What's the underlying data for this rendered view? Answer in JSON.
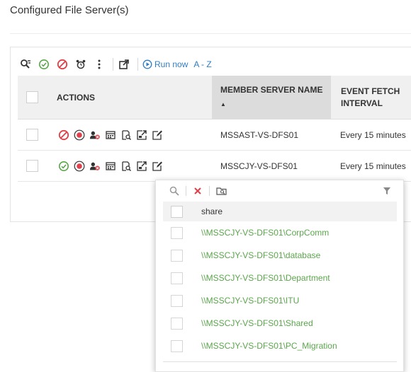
{
  "page": {
    "title": "Configured File Server(s)"
  },
  "toolbar": {
    "run_now_label": "Run now",
    "sort_label": "A - Z"
  },
  "table": {
    "columns": {
      "actions": "ACTIONS",
      "member_server": "MEMBER SERVER NAME",
      "sort_indicator": "▲",
      "interval": "EVENT FETCH INTERVAL"
    },
    "rows": [
      {
        "member_server": "MSSAST-VS-DFS01",
        "interval": "Every 15 minutes",
        "status": "disabled"
      },
      {
        "member_server": "MSSCJY-VS-DFS01",
        "interval": "Every 15 minutes",
        "status": "enabled"
      }
    ]
  },
  "share_dropdown": {
    "header": "share",
    "items": [
      "\\\\MSSCJY-VS-DFS01\\CorpComm",
      "\\\\MSSCJY-VS-DFS01\\database",
      "\\\\MSSCJY-VS-DFS01\\Department",
      "\\\\MSSCJY-VS-DFS01\\ITU",
      "\\\\MSSCJY-VS-DFS01\\Shared",
      "\\\\MSSCJY-VS-DFS01\\PC_Migration"
    ]
  },
  "colors": {
    "accent_blue": "#2f7dc2",
    "enable_green": "#5aa64b",
    "disable_red": "#e0404a",
    "header_bg": "#f0f0f0"
  },
  "icons": {
    "toolbar": [
      "search-filter-icon",
      "enable-icon",
      "disable-icon",
      "alarm-clock-icon",
      "more-options-icon",
      "export-icon",
      "run-now-icon"
    ],
    "row_actions": [
      "status-toggle-icon",
      "stop-icon",
      "user-remove-icon",
      "schedule-icon",
      "view-details-icon",
      "share-icon",
      "edit-icon"
    ]
  }
}
